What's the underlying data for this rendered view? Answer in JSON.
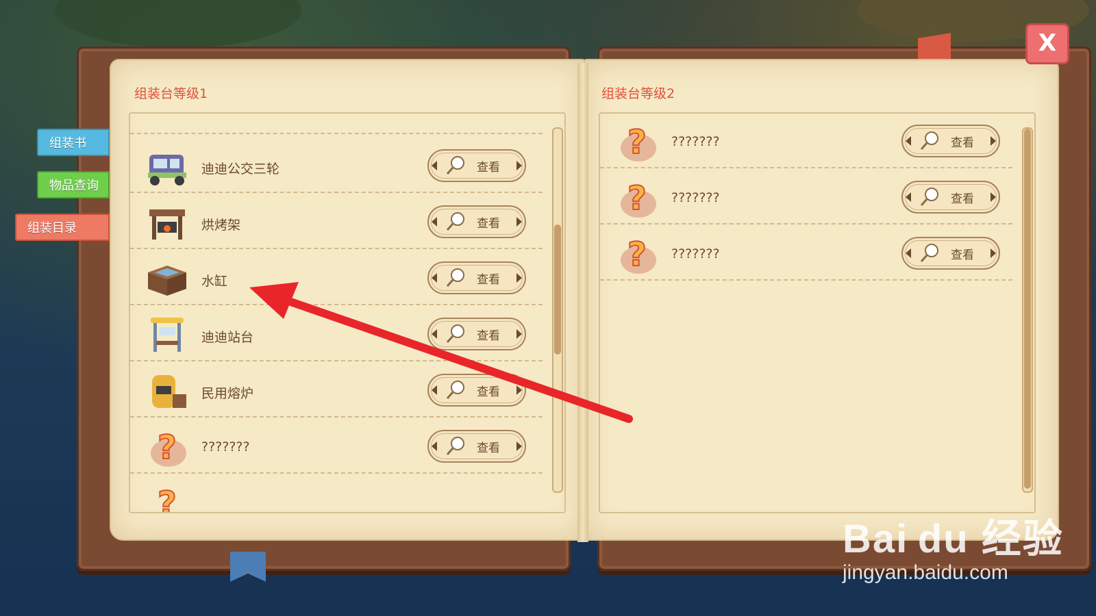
{
  "side_tabs": [
    "组装书",
    "物品查询",
    "组装目录"
  ],
  "left_page": {
    "title": "组装台等级1",
    "items": [
      {
        "name": "迪迪公交三轮",
        "icon": "tricycle-icon",
        "button": "查看"
      },
      {
        "name": "烘烤架",
        "icon": "grill-icon",
        "button": "查看"
      },
      {
        "name": "水缸",
        "icon": "water-tank-icon",
        "button": "查看"
      },
      {
        "name": "迪迪站台",
        "icon": "bus-stop-icon",
        "button": "查看"
      },
      {
        "name": "民用熔炉",
        "icon": "furnace-icon",
        "button": "查看"
      },
      {
        "name": "???????",
        "icon": "question-mark-icon",
        "button": "查看"
      }
    ]
  },
  "right_page": {
    "title": "组装台等级2",
    "items": [
      {
        "name": "???????",
        "icon": "question-mark-icon",
        "button": "查看"
      },
      {
        "name": "???????",
        "icon": "question-mark-icon",
        "button": "查看"
      },
      {
        "name": "???????",
        "icon": "question-mark-icon",
        "button": "查看"
      }
    ]
  },
  "close_label": "X",
  "watermark": {
    "logo": "Bai du 经验",
    "url": "jingyan.baidu.com"
  },
  "colors": {
    "title_red": "#e0503b",
    "arrow_red": "#e8262a",
    "page": "#f6e9c6",
    "cover": "#7b4a32"
  }
}
